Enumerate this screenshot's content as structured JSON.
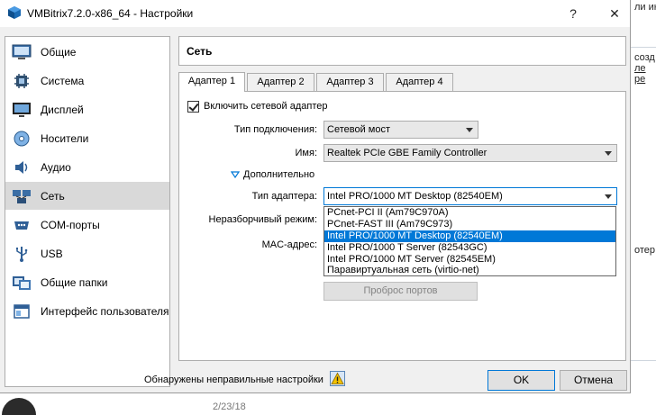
{
  "window": {
    "title": "VMBitrix7.2.0-x86_64 - Настройки",
    "help_glyph": "?",
    "close_glyph": "✕",
    "app_icon": "virtualbox-icon"
  },
  "sidebar": {
    "items": [
      {
        "label": "Общие",
        "icon": "general-icon"
      },
      {
        "label": "Система",
        "icon": "system-chip-icon"
      },
      {
        "label": "Дисплей",
        "icon": "display-monitor-icon"
      },
      {
        "label": "Носители",
        "icon": "storage-disc-icon"
      },
      {
        "label": "Аудио",
        "icon": "audio-speaker-icon"
      },
      {
        "label": "Сеть",
        "icon": "network-icon"
      },
      {
        "label": "COM-порты",
        "icon": "serial-port-icon"
      },
      {
        "label": "USB",
        "icon": "usb-icon"
      },
      {
        "label": "Общие папки",
        "icon": "shared-folder-icon"
      },
      {
        "label": "Интерфейс пользователя",
        "icon": "user-interface-icon"
      }
    ],
    "active_index": 5
  },
  "content": {
    "section_title": "Сеть",
    "tabs": [
      "Адаптер 1",
      "Адаптер 2",
      "Адаптер 3",
      "Адаптер 4"
    ],
    "active_tab": 0,
    "enable_adapter": {
      "label": "Включить сетевой адаптер",
      "checked": true
    },
    "attached_to": {
      "label": "Тип подключения:",
      "value": "Сетевой мост"
    },
    "name": {
      "label": "Имя:",
      "value": "Realtek PCIe GBE Family Controller"
    },
    "advanced": {
      "label": "Дополнительно",
      "expanded": true
    },
    "adapter_type": {
      "label": "Тип адаптера:",
      "value": "Intel PRO/1000 MT Desktop (82540EM)",
      "options": [
        "PCnet-PCI II (Am79C970A)",
        "PCnet-FAST III (Am79C973)",
        "Intel PRO/1000 MT Desktop (82540EM)",
        "Intel PRO/1000 T Server (82543GC)",
        "Intel PRO/1000 MT Server (82545EM)",
        "Паравиртуальная сеть (virtio-net)"
      ],
      "selected_option_index": 2
    },
    "promiscuous_label": "Неразборчивый режим:",
    "mac_label": "MAC-адрес:",
    "port_forwarding_label": "Проброс портов"
  },
  "footer": {
    "warning_text": "Обнаружены неправильные настройки",
    "warning_icon": "invalid-settings-warning-icon",
    "ok_label": "OK",
    "cancel_label": "Отмена"
  },
  "background": {
    "right_fragments": [
      "ли ине",
      "созд",
      "ле",
      "ре",
      "отер"
    ],
    "date_fragment": "2/23/18"
  },
  "colors": {
    "selection": "#0078d7",
    "sidebar_active": "#d9d9d9",
    "dialog_bg": "#f0f0f0"
  }
}
